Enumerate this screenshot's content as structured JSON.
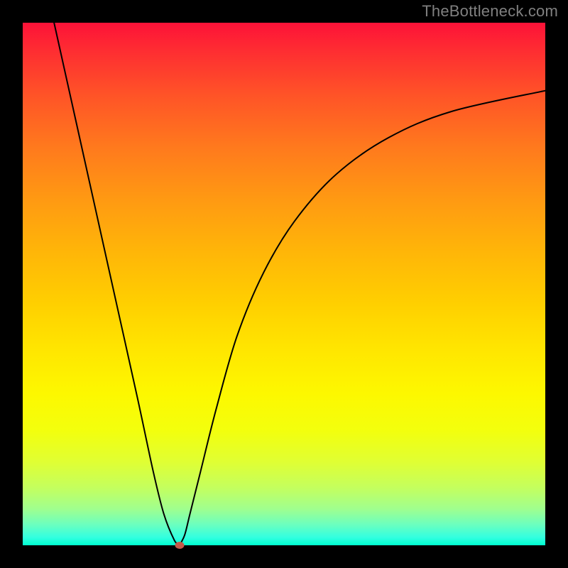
{
  "watermark": "TheBottleneck.com",
  "chart_data": {
    "type": "line",
    "title": "",
    "xlabel": "",
    "ylabel": "",
    "xlim": [
      0,
      100
    ],
    "ylim": [
      0,
      100
    ],
    "grid": false,
    "legend": false,
    "background": "rainbow-gradient",
    "series": [
      {
        "name": "curve-left",
        "x": [
          6,
          10,
          14,
          18,
          22,
          25,
          27,
          29,
          30
        ],
        "y": [
          100,
          82,
          64,
          46,
          28,
          14,
          6,
          1,
          0
        ]
      },
      {
        "name": "curve-right",
        "x": [
          30,
          31,
          32,
          34,
          37,
          41,
          46,
          52,
          60,
          70,
          82,
          100
        ],
        "y": [
          0,
          2,
          6,
          14,
          26,
          40,
          52,
          62,
          71,
          78,
          83,
          87
        ]
      }
    ],
    "marker": {
      "x": 30,
      "y": 0,
      "color": "#c55a4a"
    }
  }
}
